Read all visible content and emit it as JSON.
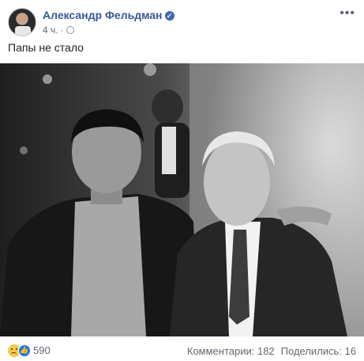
{
  "post": {
    "author": "Александр Фельдман",
    "time": "4 ч.",
    "dot": "·",
    "text": "Папы не стало",
    "more_icon": "more-horizontal-icon",
    "privacy_icon": "globe-icon",
    "verified_icon": "verified-badge-icon"
  },
  "photo": {
    "kind": "black-and-white photograph of two men"
  },
  "footer": {
    "reactions": [
      "sad",
      "like"
    ],
    "reaction_count": "590",
    "comments": "Комментарии: 182",
    "shares": "Поделились: 16"
  },
  "colors": {
    "link": "#385898",
    "meta": "#616770",
    "like_blue": "#1877f2",
    "verified_blue": "#4267b2"
  }
}
